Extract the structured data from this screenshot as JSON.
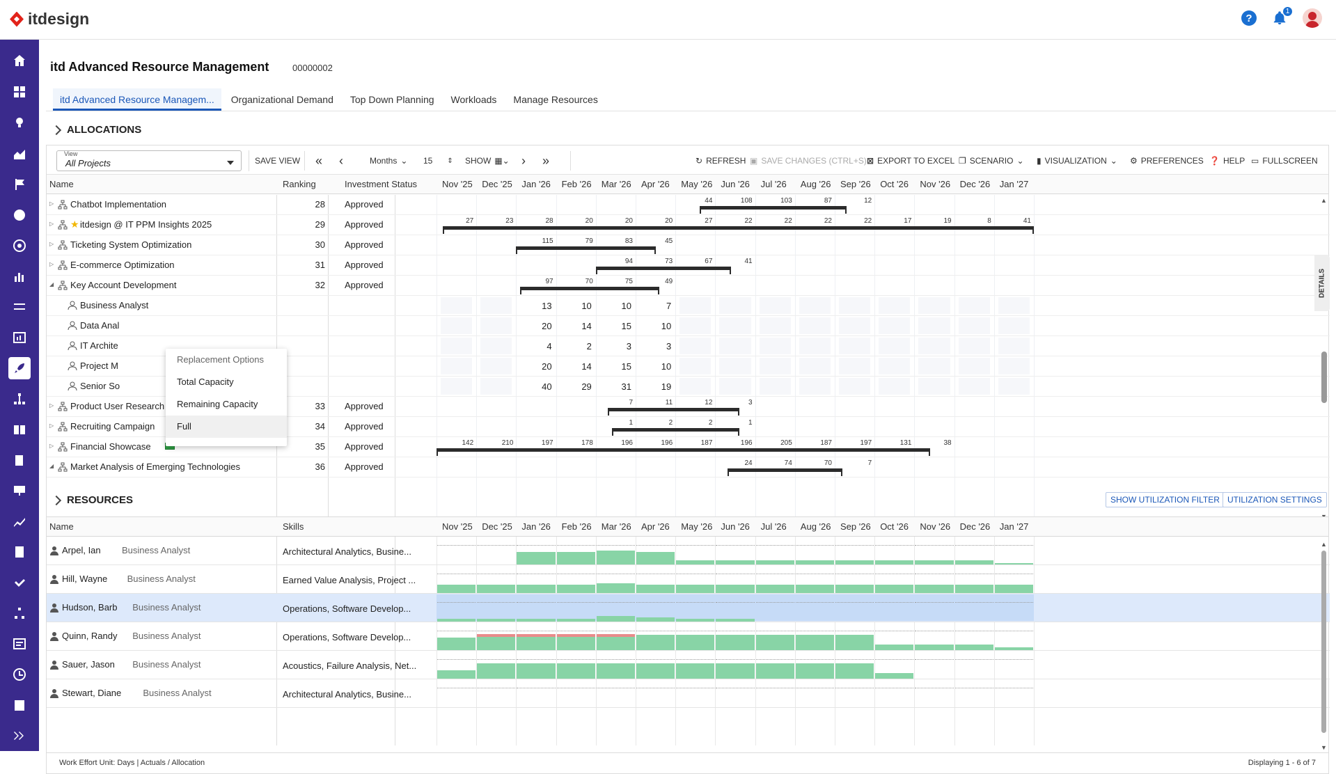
{
  "app": {
    "logo_text": "itdesign",
    "notification_count": "1",
    "help_glyph": "?"
  },
  "page": {
    "title": "itd Advanced Resource Management",
    "id": "00000002"
  },
  "tabs": [
    {
      "label": "itd Advanced Resource Managem..."
    },
    {
      "label": "Organizational Demand"
    },
    {
      "label": "Top Down Planning"
    },
    {
      "label": "Workloads"
    },
    {
      "label": "Manage Resources"
    }
  ],
  "allocations": {
    "section_title": "ALLOCATIONS",
    "toolbar": {
      "view_label": "View",
      "view_value": "All Projects",
      "save_view": "SAVE VIEW",
      "period": "Months",
      "count": "15",
      "show": "SHOW",
      "refresh": "REFRESH",
      "save_changes": "SAVE CHANGES (CTRL+S)",
      "export": "EXPORT TO EXCEL",
      "scenario": "SCENARIO",
      "visualization": "VISUALIZATION",
      "preferences": "PREFERENCES",
      "help": "HELP",
      "fullscreen": "FULLSCREEN"
    },
    "columns": {
      "name": "Name",
      "ranking": "Ranking",
      "investment_status": "Investment Status"
    },
    "months": [
      "Nov '25",
      "Dec '25",
      "Jan '26",
      "Feb '26",
      "Mar '26",
      "Apr '26",
      "May '26",
      "Jun '26",
      "Jul '26",
      "Aug '26",
      "Sep '26",
      "Oct '26",
      "Nov '26",
      "Dec '26",
      "Jan '27"
    ],
    "rows": [
      {
        "name": "Chatbot Implementation",
        "ranking": "28",
        "status": "Approved",
        "type": "project"
      },
      {
        "name": "itdesign @ IT PPM Insights 2025",
        "ranking": "29",
        "status": "Approved",
        "type": "project",
        "star": true
      },
      {
        "name": "Ticketing System Optimization",
        "ranking": "30",
        "status": "Approved",
        "type": "project"
      },
      {
        "name": "E-commerce Optimization",
        "ranking": "31",
        "status": "Approved",
        "type": "project"
      },
      {
        "name": "Key Account Development",
        "ranking": "32",
        "status": "Approved",
        "type": "project",
        "expanded": true
      },
      {
        "name": "Business Analyst",
        "type": "role"
      },
      {
        "name": "Data Anal",
        "type": "role"
      },
      {
        "name": "IT Archite",
        "type": "role"
      },
      {
        "name": "Project M",
        "type": "role"
      },
      {
        "name": "Senior So",
        "type": "role"
      },
      {
        "name": "Product User Research Studies",
        "ranking": "33",
        "status": "Approved",
        "type": "project"
      },
      {
        "name": "Recruiting Campaign",
        "ranking": "34",
        "status": "Approved",
        "type": "project"
      },
      {
        "name": "Financial Showcase",
        "ranking": "35",
        "status": "Approved",
        "type": "project",
        "money": true
      },
      {
        "name": "Market Analysis of Emerging Technologies",
        "ranking": "36",
        "status": "Approved",
        "type": "project",
        "expanded": true
      }
    ],
    "gantt": [
      {
        "row": 0,
        "bar": [
          6.6,
          10.3
        ],
        "labels": [
          [
            6,
            "44"
          ],
          [
            7,
            "108"
          ],
          [
            8,
            "103"
          ],
          [
            9,
            "87"
          ],
          [
            10,
            "12"
          ]
        ]
      },
      {
        "row": 1,
        "bar": [
          0.15,
          15.0
        ],
        "labels": [
          [
            0,
            "27"
          ],
          [
            1,
            "23"
          ],
          [
            2,
            "28"
          ],
          [
            3,
            "20"
          ],
          [
            4,
            "20"
          ],
          [
            5,
            "20"
          ],
          [
            6,
            "27"
          ],
          [
            7,
            "22"
          ],
          [
            8,
            "22"
          ],
          [
            9,
            "22"
          ],
          [
            10,
            "22"
          ],
          [
            11,
            "17"
          ],
          [
            12,
            "19"
          ],
          [
            13,
            "8"
          ],
          [
            14,
            "41"
          ]
        ]
      },
      {
        "row": 2,
        "bar": [
          2.0,
          5.5
        ],
        "labels": [
          [
            2,
            "115"
          ],
          [
            3,
            "79"
          ],
          [
            4,
            "83"
          ],
          [
            5,
            "45"
          ]
        ]
      },
      {
        "row": 3,
        "bar": [
          4.0,
          7.4
        ],
        "labels": [
          [
            4,
            "94"
          ],
          [
            5,
            "73"
          ],
          [
            6,
            "67"
          ],
          [
            7,
            "41"
          ]
        ]
      },
      {
        "row": 4,
        "bar": [
          2.1,
          5.6
        ],
        "labels": [
          [
            2,
            "97"
          ],
          [
            3,
            "70"
          ],
          [
            4,
            "75"
          ],
          [
            5,
            "49"
          ]
        ]
      },
      {
        "row": 5,
        "big": [
          [
            2,
            "13"
          ],
          [
            3,
            "10"
          ],
          [
            4,
            "10"
          ],
          [
            5,
            "7"
          ]
        ]
      },
      {
        "row": 6,
        "big": [
          [
            2,
            "20"
          ],
          [
            3,
            "14"
          ],
          [
            4,
            "15"
          ],
          [
            5,
            "10"
          ]
        ]
      },
      {
        "row": 7,
        "big": [
          [
            2,
            "4"
          ],
          [
            3,
            "2"
          ],
          [
            4,
            "3"
          ],
          [
            5,
            "3"
          ]
        ]
      },
      {
        "row": 8,
        "big": [
          [
            2,
            "20"
          ],
          [
            3,
            "14"
          ],
          [
            4,
            "15"
          ],
          [
            5,
            "10"
          ]
        ]
      },
      {
        "row": 9,
        "big": [
          [
            2,
            "40"
          ],
          [
            3,
            "29"
          ],
          [
            4,
            "31"
          ],
          [
            5,
            "19"
          ]
        ]
      },
      {
        "row": 10,
        "bar": [
          4.3,
          7.6
        ],
        "labels": [
          [
            4,
            "7"
          ],
          [
            5,
            "11"
          ],
          [
            6,
            "12"
          ],
          [
            7,
            "3"
          ]
        ]
      },
      {
        "row": 11,
        "bar": [
          4.4,
          7.6
        ],
        "labels": [
          [
            4,
            "1"
          ],
          [
            5,
            "2"
          ],
          [
            6,
            "2"
          ],
          [
            7,
            "1"
          ]
        ]
      },
      {
        "row": 12,
        "bar": [
          0.0,
          12.4
        ],
        "labels": [
          [
            0,
            "142"
          ],
          [
            1,
            "210"
          ],
          [
            2,
            "197"
          ],
          [
            3,
            "178"
          ],
          [
            4,
            "196"
          ],
          [
            5,
            "196"
          ],
          [
            6,
            "187"
          ],
          [
            7,
            "196"
          ],
          [
            8,
            "205"
          ],
          [
            9,
            "187"
          ],
          [
            10,
            "197"
          ],
          [
            11,
            "131"
          ],
          [
            12,
            "38"
          ]
        ]
      },
      {
        "row": 13,
        "bar": [
          7.3,
          10.2
        ],
        "labels": [
          [
            7,
            "24"
          ],
          [
            8,
            "74"
          ],
          [
            9,
            "70"
          ],
          [
            10,
            "7"
          ]
        ]
      }
    ]
  },
  "context_menu": {
    "header": "Replacement Options",
    "items": [
      "Total Capacity",
      "Remaining Capacity",
      "Full"
    ]
  },
  "details_label": "DETAILS",
  "resources": {
    "section_title": "RESOURCES",
    "show_filter": "SHOW UTILIZATION FILTER",
    "settings": "UTILIZATION SETTINGS",
    "columns": {
      "name": "Name",
      "skills": "Skills"
    },
    "rows": [
      {
        "name": "Arpel, Ian",
        "role": "Business Analyst",
        "skills": "Architectural Analytics, Busine...",
        "fill": [
          0,
          0,
          0.45,
          0.45,
          0.5,
          0.45,
          0.15,
          0.15,
          0.15,
          0.15,
          0.15,
          0.15,
          0.15,
          0.15,
          0.05
        ]
      },
      {
        "name": "Hill, Wayne",
        "role": "Business Analyst",
        "skills": "Earned Value Analysis, Project ...",
        "fill": [
          0.3,
          0.3,
          0.3,
          0.3,
          0.35,
          0.3,
          0.3,
          0.3,
          0.3,
          0.3,
          0.3,
          0.3,
          0.3,
          0.3,
          0.3
        ]
      },
      {
        "name": "Hudson, Barb",
        "role": "Business Analyst",
        "skills": "Operations, Software Develop...",
        "fill": [
          0.1,
          0.1,
          0.1,
          0.1,
          0.2,
          0.15,
          0.1,
          0.1,
          0,
          0,
          0,
          0,
          0,
          0,
          0
        ],
        "selected": true
      },
      {
        "name": "Quinn, Randy",
        "role": "Business Analyst",
        "skills": "Operations, Software Develop...",
        "fill": [
          0.45,
          0.55,
          0.55,
          0.55,
          0.55,
          0.55,
          0.55,
          0.55,
          0.55,
          0.55,
          0.55,
          0.2,
          0.2,
          0.2,
          0.1
        ],
        "over": [
          0,
          1,
          1,
          1,
          1,
          0,
          0,
          0,
          0,
          0,
          0,
          0,
          0,
          0,
          0
        ]
      },
      {
        "name": "Sauer, Jason",
        "role": "Business Analyst",
        "skills": "Acoustics, Failure Analysis, Net...",
        "fill": [
          0.3,
          0.55,
          0.55,
          0.55,
          0.55,
          0.55,
          0.55,
          0.55,
          0.55,
          0.55,
          0.55,
          0.2,
          0,
          0,
          0
        ]
      },
      {
        "name": "Stewart, Diane",
        "role": "Business Analyst",
        "skills": "Architectural Analytics, Busine...",
        "fill": [
          0,
          0,
          0,
          0,
          0,
          0,
          0,
          0,
          0,
          0,
          0,
          0,
          0,
          0,
          0
        ]
      }
    ]
  },
  "footer": {
    "left": "Work Effort Unit: Days  |  Actuals / Allocation",
    "right": "Displaying 1 - 6 of 7"
  },
  "colors": {
    "brand": "#3a2a8c",
    "accent": "#1a57b8",
    "alloc": "#88d4a6",
    "over": "#e98b8b"
  }
}
